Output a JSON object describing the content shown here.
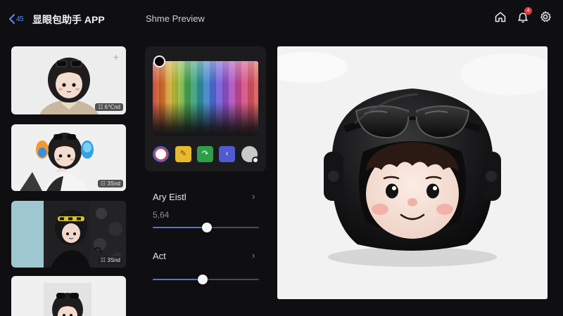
{
  "header": {
    "back_badge": "45",
    "app_title": "显眼包助手 APP",
    "screen_title": "Shme Preview",
    "notification_count": "4",
    "icons": [
      "home-icon",
      "bell-icon",
      "gear-icon"
    ]
  },
  "thumbnails": [
    {
      "badge": "☷ 6℃nd"
    },
    {
      "badge": "☷ 3Snd"
    },
    {
      "badge": "☷ 3Snd"
    },
    {
      "badge": ""
    }
  ],
  "color_panel": {
    "selected_color": "#000000",
    "swatches": [
      {
        "name": "white-red-ring",
        "color": "#ffffff"
      },
      {
        "name": "yellow",
        "color": "#e8b82e"
      },
      {
        "name": "green",
        "color": "#2f9e4a"
      },
      {
        "name": "indigo",
        "color": "#4f5bd0"
      },
      {
        "name": "gray",
        "color": "#c9c9c9"
      }
    ]
  },
  "adjustments": [
    {
      "label": "Ary Eistl",
      "value": "5,64",
      "level": 0.51
    },
    {
      "label": "Act",
      "value": "",
      "level": 0.47
    }
  ],
  "colors": {
    "accent": "#3d7bf2",
    "badge": "#e5383b",
    "background": "#0f0f11",
    "panel": "#1c1c1f"
  }
}
